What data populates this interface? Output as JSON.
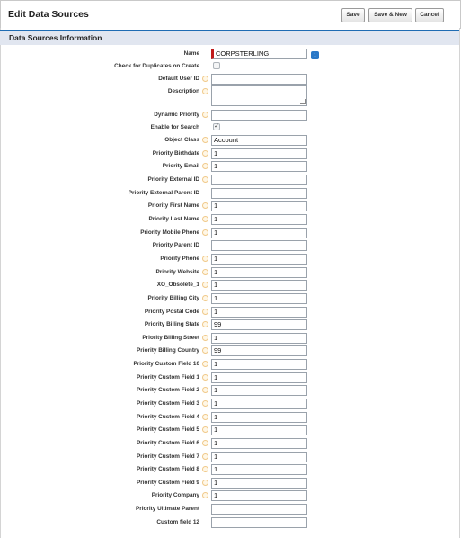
{
  "header": {
    "title": "Edit Data Sources",
    "buttons": {
      "save": "Save",
      "save_new": "Save & New",
      "cancel": "Cancel"
    }
  },
  "section": {
    "title": "Data Sources Information"
  },
  "colors": {
    "section_accent": "#1f6cb3",
    "required": "#c11b1b",
    "info": "#2a78c7"
  },
  "fields": [
    {
      "label": "Name",
      "type": "text",
      "value": "CORPSTERLING",
      "required": true,
      "info_icon": "info-icon"
    },
    {
      "label": "Check for Duplicates on Create",
      "type": "checkbox",
      "checked": false
    },
    {
      "label": "Default User ID",
      "type": "text",
      "value": ""
    },
    {
      "label": "Description",
      "type": "textarea",
      "value": ""
    },
    {
      "label": "Dynamic Priority",
      "type": "text",
      "value": ""
    },
    {
      "label": "Enable for Search",
      "type": "checkbox",
      "checked": true
    },
    {
      "label": "Object Class",
      "type": "text",
      "value": "Account"
    },
    {
      "label": "Priority Birthdate",
      "type": "text",
      "value": "1"
    },
    {
      "label": "Priority Email",
      "type": "text",
      "value": "1"
    },
    {
      "label": "Priority External ID",
      "type": "text",
      "value": ""
    },
    {
      "label": "Priority External Parent ID",
      "type": "text",
      "value": "",
      "no_help": true
    },
    {
      "label": "Priority First Name",
      "type": "text",
      "value": "1"
    },
    {
      "label": "Priority Last Name",
      "type": "text",
      "value": "1"
    },
    {
      "label": "Priority Mobile Phone",
      "type": "text",
      "value": "1"
    },
    {
      "label": "Priority Parent ID",
      "type": "text",
      "value": "",
      "no_help": true
    },
    {
      "label": "Priority Phone",
      "type": "text",
      "value": "1"
    },
    {
      "label": "Priority Website",
      "type": "text",
      "value": "1"
    },
    {
      "label": "XO_Obsolete_1",
      "type": "text",
      "value": "1"
    },
    {
      "label": "Priority Billing City",
      "type": "text",
      "value": "1"
    },
    {
      "label": "Priority Postal Code",
      "type": "text",
      "value": "1"
    },
    {
      "label": "Priority Billing State",
      "type": "text",
      "value": "99"
    },
    {
      "label": "Priority Billing Street",
      "type": "text",
      "value": "1"
    },
    {
      "label": "Priority Billing Country",
      "type": "text",
      "value": "99"
    },
    {
      "label": "Priority Custom Field 10",
      "type": "text",
      "value": "1"
    },
    {
      "label": "Priority Custom Field 1",
      "type": "text",
      "value": "1"
    },
    {
      "label": "Priority Custom Field 2",
      "type": "text",
      "value": "1"
    },
    {
      "label": "Priority Custom Field 3",
      "type": "text",
      "value": "1"
    },
    {
      "label": "Priority Custom Field 4",
      "type": "text",
      "value": "1"
    },
    {
      "label": "Priority Custom Field 5",
      "type": "text",
      "value": "1"
    },
    {
      "label": "Priority Custom Field 6",
      "type": "text",
      "value": "1"
    },
    {
      "label": "Priority Custom Field 7",
      "type": "text",
      "value": "1"
    },
    {
      "label": "Priority Custom Field 8",
      "type": "text",
      "value": "1"
    },
    {
      "label": "Priority Custom Field 9",
      "type": "text",
      "value": "1"
    },
    {
      "label": "Priority Company",
      "type": "text",
      "value": "1"
    },
    {
      "label": "Priority Ultimate Parent",
      "type": "text",
      "value": "",
      "no_help": true
    },
    {
      "label": "Custom field 12",
      "type": "text",
      "value": "",
      "no_help": true
    }
  ]
}
